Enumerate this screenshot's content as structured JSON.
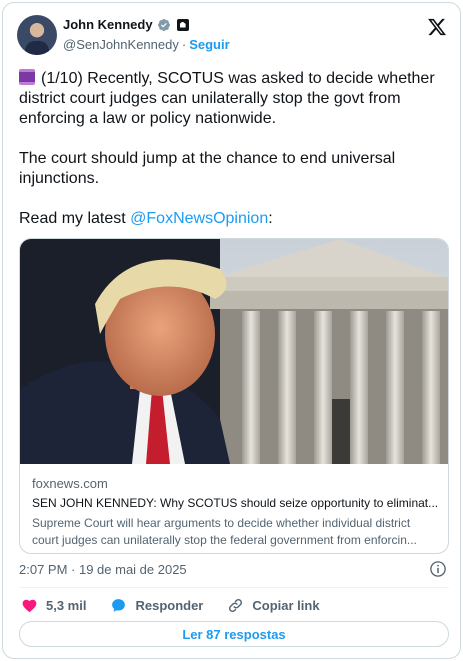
{
  "author": {
    "name": "John Kennedy",
    "handle": "@SenJohnKennedy",
    "separator": "·",
    "follow_label": "Seguir"
  },
  "icons": {
    "verified": "verified-badge-icon",
    "government": "government-label-icon",
    "logo": "x-logo-icon",
    "thread": "thread-spool-emoji",
    "like": "heart-icon",
    "reply": "reply-bubble-icon",
    "copy_link": "link-icon",
    "info": "info-icon"
  },
  "tweet": {
    "line1": "(1/10) Recently, SCOTUS was asked to decide whether district court judges can unilaterally stop the govt from enforcing a law or policy nationwide.",
    "line2": "The court should jump at the chance to end universal injunctions.",
    "line3_prefix": "Read my latest ",
    "mention": "@FoxNewsOpinion",
    "line3_suffix": ":"
  },
  "link_card": {
    "domain": "foxnews.com",
    "title": "SEN JOHN KENNEDY: Why SCOTUS should seize opportunity to eliminat...",
    "description": "Supreme Court will hear arguments to decide whether individual district court judges can unilaterally stop the federal government from enforcin..."
  },
  "timestamp": "2:07 PM · 19 de mai de 2025",
  "actions": {
    "like_count": "5,3 mil",
    "reply_label": "Responder",
    "copy_label": "Copiar link"
  },
  "replies_button": "Ler 87 respostas",
  "colors": {
    "accent": "#1d9bf0",
    "like": "#f91880",
    "text": "#0f1419",
    "secondary": "#536471",
    "border": "#cfd9de"
  }
}
